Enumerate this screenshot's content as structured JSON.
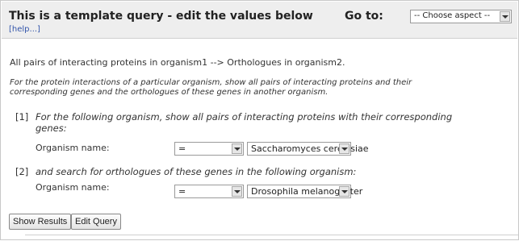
{
  "header": {
    "title": "This is a template query - edit the values below",
    "help_link": "[help...]",
    "goto_label": "Go to:",
    "goto_select_value": "-- Choose aspect --"
  },
  "query": {
    "title": "All pairs of interacting proteins in organism1 --> Orthologues in organism2.",
    "description_line1": "For the protein interactions of a particular organism, show all pairs of interacting proteins and their",
    "description_line2": "corresponding genes and the orthologues of these genes in another organism."
  },
  "steps": [
    {
      "number": "[1]",
      "text_line1": "For the following organism, show all pairs of interacting proteins with their corresponding",
      "text_line2": "genes:",
      "field_label": "Organism name:",
      "operator": "=",
      "value": "Saccharomyces cerevisiae"
    },
    {
      "number": "[2]",
      "text_line1": "and search for orthologues of these genes in the following organism:",
      "field_label": "Organism name:",
      "operator": "=",
      "value": "Drosophila melanogaster"
    }
  ],
  "buttons": {
    "show_results": "Show Results",
    "edit_query": "Edit Query"
  }
}
